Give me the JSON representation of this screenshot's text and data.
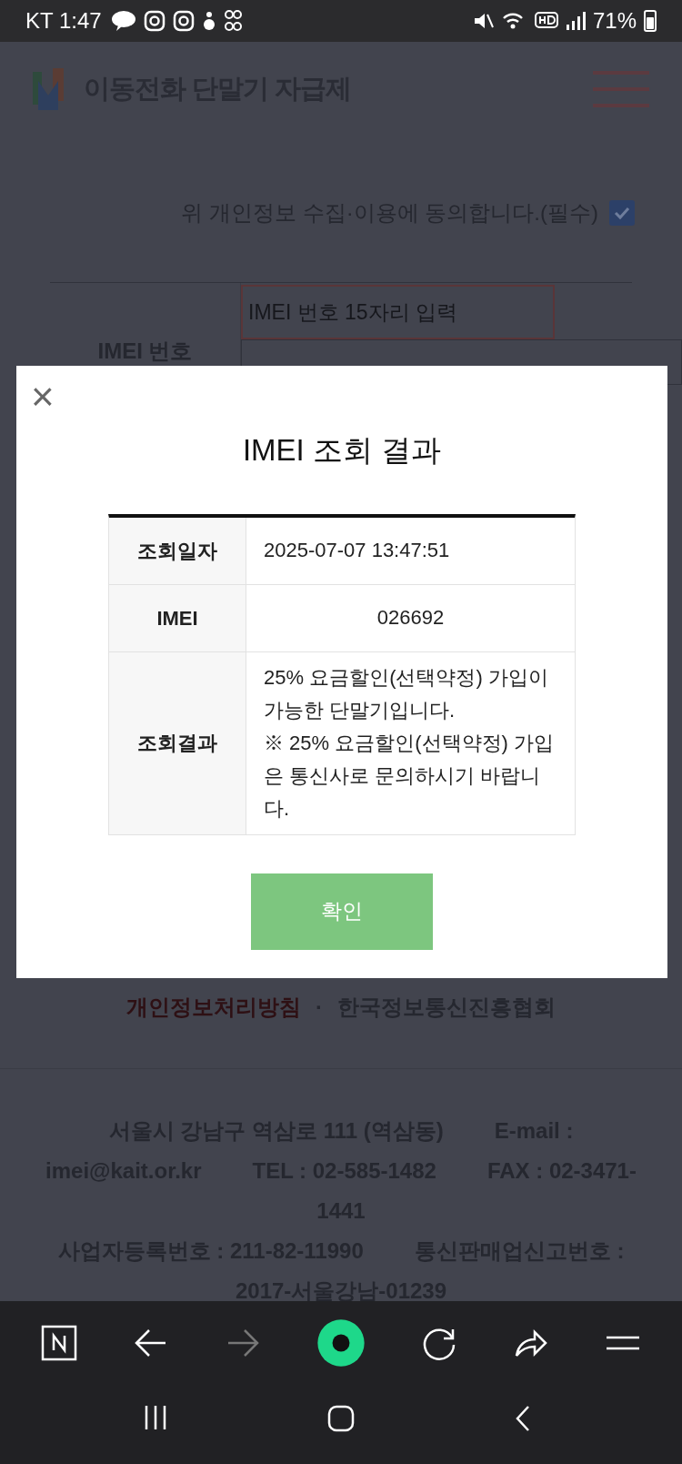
{
  "status_bar": {
    "carrier": "KT",
    "time": "1:47",
    "battery": "71%"
  },
  "header": {
    "title": "이동전화 단말기 자급제"
  },
  "consent": {
    "label": "위 개인정보 수집·이용에 동의합니다.(필수)",
    "checked": true
  },
  "imei_form": {
    "label": "IMEI 번호",
    "placeholder": "IMEI 번호 15자리 입력"
  },
  "modal": {
    "close": "×",
    "title": "IMEI 조회 결과",
    "rows": [
      {
        "label": "조회일자",
        "value": "2025-07-07 13:47:51",
        "kind": "text"
      },
      {
        "label": "IMEI",
        "value": "026692",
        "kind": "number"
      },
      {
        "label": "조회결과",
        "value": "25% 요금할인(선택약정) 가입이 가능한 단말기입니다.\n※ 25% 요금할인(선택약정) 가입은 통신사로 문의하시기 바랍니다.",
        "kind": "text"
      }
    ],
    "button": "확인"
  },
  "footer": {
    "links": [
      {
        "label": "개인정보처리방침",
        "kind": "policy"
      },
      {
        "label": "한국정보통신진흥협회",
        "kind": "org"
      }
    ],
    "separator": "·",
    "address_lines": [
      [
        "서울시 강남구 역삼로 111 (역삼동)",
        "E-mail :"
      ],
      [
        "imei@kait.or.kr",
        "TEL : 02-585-1482",
        "FAX : 02-3471-"
      ],
      [
        "1441"
      ],
      [
        "사업자등록번호 : 211-82-11990",
        "통신판매업신고번호 :"
      ],
      [
        "2017-서울강남-01239"
      ]
    ]
  },
  "browser_toolbar": [
    {
      "kind": "naver",
      "disabled": false
    },
    {
      "kind": "back",
      "disabled": false
    },
    {
      "kind": "forward",
      "disabled": true
    },
    {
      "kind": "green",
      "disabled": false
    },
    {
      "kind": "reload",
      "disabled": false
    },
    {
      "kind": "share",
      "disabled": false
    },
    {
      "kind": "menu",
      "disabled": false
    }
  ],
  "nav_bar": [
    {
      "kind": "recents"
    },
    {
      "kind": "home"
    },
    {
      "kind": "back"
    }
  ]
}
